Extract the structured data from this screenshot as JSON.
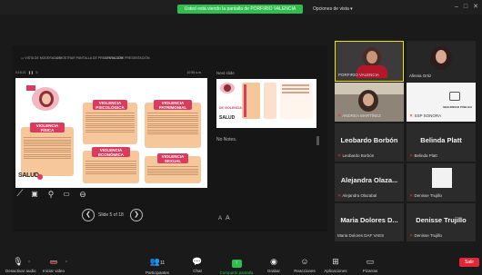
{
  "top_bar": {
    "share_banner": "Usted está viendo la pantalla de PORFIRIO VALENCIA",
    "view_options": "Opciones de vista",
    "colors": {
      "share_green": "#2fbe4f"
    }
  },
  "share_toolbar": {
    "items": [
      "VISTA DE MODERADOR",
      "MOSTRAR PANTALLA DE PRESENTACIÓN",
      "FINALIZAR PRESENTACIÓN"
    ]
  },
  "presenter": {
    "elapsed_time": "0:15:21",
    "clock": "10:55 a.m.",
    "next_slide_label": "Next slide",
    "notes": "No Notes.",
    "slide_counter": "Slide 5 of 18"
  },
  "slide": {
    "cards": [
      {
        "title": "VIOLENCIA FÍSICA"
      },
      {
        "title": "VIOLENCIA PSICOLÓGICA"
      },
      {
        "title": "VIOLENCIA PATRIMONIAL"
      },
      {
        "title": "VIOLENCIA ECONÓMICA"
      },
      {
        "title": "VIOLENCIA SEXUAL"
      }
    ],
    "logo_text": "SALUD",
    "thumb_heading": "DE VIOLENCIA",
    "colors": {
      "pink": "#d93c5f",
      "peach": "#f6c79b"
    }
  },
  "participants": {
    "video_tiles": [
      {
        "name": "PORFIRIO VALENCIA",
        "active_speaker": true
      },
      {
        "name": "Alinnia Ortiz"
      },
      {
        "name": "ANDREA MARTÍNEZ"
      },
      {
        "name": "SSP SONORA"
      }
    ],
    "name_tiles": [
      {
        "big": "Leobardo Borbón",
        "small": "Leobardo Borbón"
      },
      {
        "big": "Belinda Platt",
        "small": "Belinda Platt"
      },
      {
        "big": "Alejandra Olaza...",
        "small": "Alejandra Olazabal"
      },
      {
        "big": "",
        "small": "Denisse Trujillo"
      },
      {
        "big": "Maria Dolores D...",
        "small": "Maria Dolores DAF VAES"
      },
      {
        "big": "Denisse Trujillo",
        "small": "Denisse Trujillo"
      }
    ],
    "seguridad_label": "SEGURIDAD PÚBLICA"
  },
  "bottom_bar": {
    "items": [
      {
        "label": "Desactivar audio",
        "icon": "microphone-icon"
      },
      {
        "label": "Iniciar video",
        "icon": "video-off-icon"
      },
      {
        "label": "Participantes",
        "icon": "participants-icon",
        "count": "11"
      },
      {
        "label": "Chat",
        "icon": "chat-icon"
      },
      {
        "label": "Compartir pantalla",
        "icon": "share-screen-icon"
      },
      {
        "label": "Grabar",
        "icon": "record-icon"
      },
      {
        "label": "Reacciones",
        "icon": "reactions-icon"
      },
      {
        "label": "Aplicaciones",
        "icon": "apps-icon"
      },
      {
        "label": "Pizarras",
        "icon": "whiteboard-icon"
      }
    ],
    "leave_label": "Salir",
    "colors": {
      "leave_red": "#e0283a",
      "share_green": "#2fbe4f"
    }
  }
}
